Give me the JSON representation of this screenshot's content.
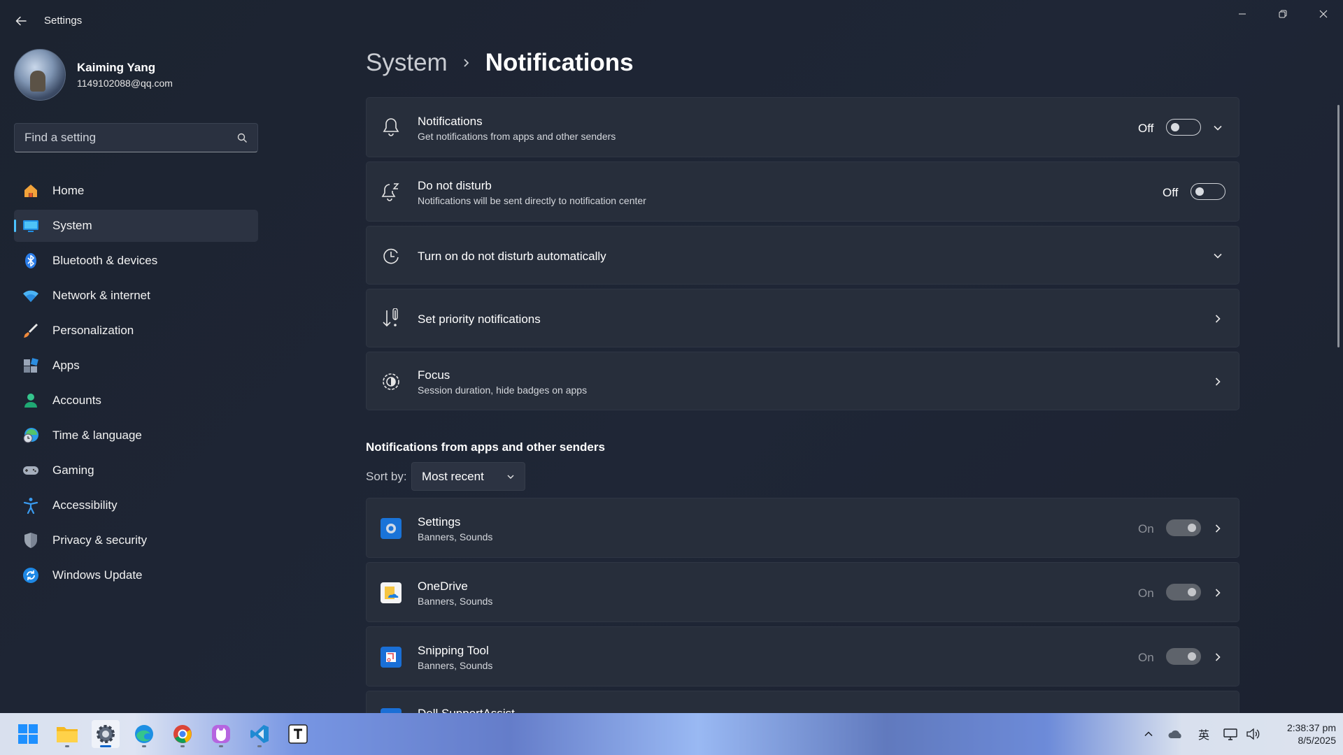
{
  "window": {
    "title": "Settings"
  },
  "profile": {
    "name": "Kaiming Yang",
    "email": "1149102088@qq.com"
  },
  "search": {
    "placeholder": "Find a setting"
  },
  "nav": {
    "items": [
      {
        "label": "Home",
        "icon": "home-icon"
      },
      {
        "label": "System",
        "icon": "system-icon",
        "active": true
      },
      {
        "label": "Bluetooth & devices",
        "icon": "bluetooth-icon"
      },
      {
        "label": "Network & internet",
        "icon": "wifi-icon"
      },
      {
        "label": "Personalization",
        "icon": "brush-icon"
      },
      {
        "label": "Apps",
        "icon": "apps-icon"
      },
      {
        "label": "Accounts",
        "icon": "person-icon"
      },
      {
        "label": "Time & language",
        "icon": "globe-clock-icon"
      },
      {
        "label": "Gaming",
        "icon": "gamepad-icon"
      },
      {
        "label": "Accessibility",
        "icon": "accessibility-icon"
      },
      {
        "label": "Privacy & security",
        "icon": "shield-icon"
      },
      {
        "label": "Windows Update",
        "icon": "update-icon"
      }
    ]
  },
  "breadcrumb": {
    "parent": "System",
    "current": "Notifications"
  },
  "cards": {
    "notifications": {
      "title": "Notifications",
      "subtitle": "Get notifications from apps and other senders",
      "state": "Off"
    },
    "dnd": {
      "title": "Do not disturb",
      "subtitle": "Notifications will be sent directly to notification center",
      "state": "Off"
    },
    "auto_dnd": {
      "title": "Turn on do not disturb automatically"
    },
    "priority": {
      "title": "Set priority notifications"
    },
    "focus": {
      "title": "Focus",
      "subtitle": "Session duration, hide badges on apps"
    }
  },
  "senders": {
    "section_title": "Notifications from apps and other senders",
    "sort_label": "Sort by:",
    "sort_value": "Most recent",
    "apps": [
      {
        "name": "Settings",
        "detail": "Banners, Sounds",
        "state": "On"
      },
      {
        "name": "OneDrive",
        "detail": "Banners, Sounds",
        "state": "On"
      },
      {
        "name": "Snipping Tool",
        "detail": "Banners, Sounds",
        "state": "On"
      },
      {
        "name": "Dell SupportAssist",
        "detail": "",
        "state": ""
      }
    ]
  },
  "taskbar": {
    "ime": "英",
    "time": "2:38:37 pm",
    "date": "8/5/2025"
  },
  "colors": {
    "accent": "#4cc2ff",
    "background": "#1d2431",
    "card": "#272e3b"
  }
}
